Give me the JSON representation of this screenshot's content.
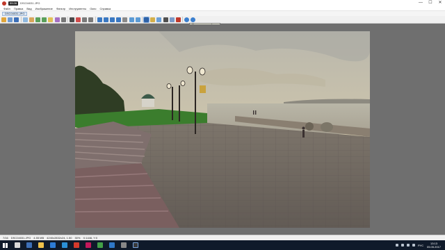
{
  "titlebar": {
    "rec_label": "59:28",
    "title": "DSC04031.JPG",
    "minimize": "—",
    "maximize": "☐",
    "close": "✕"
  },
  "menu": [
    "Файл",
    "Правка",
    "Вид",
    "Изображение",
    "Фильтр",
    "Инструменты",
    "Окно",
    "Справка"
  ],
  "tab": {
    "label": "DSC04031.JPG"
  },
  "tooltip": {
    "text": "Полноэкранный вид"
  },
  "statusbar": {
    "index": "7/16",
    "filename": "DSC04031.JPG",
    "filesize": "4.55 MB",
    "dimensions": "4240x2832x24, 1.50",
    "zoom": "30%",
    "coords": "X:1446, Y:0"
  },
  "taskbar": {
    "lang": "РУС",
    "time": "13:13",
    "date": "05.05.2017"
  },
  "colors": {
    "accent": "#2d7cd6",
    "taskbar": "#0f1a2a"
  }
}
